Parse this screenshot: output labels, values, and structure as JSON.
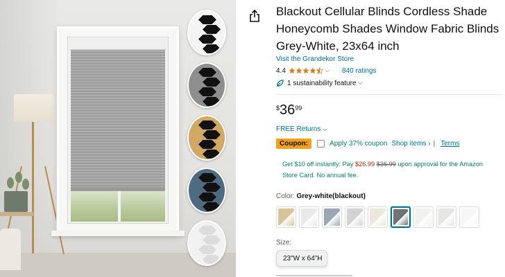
{
  "product": {
    "title": "Blackout Cellular Blinds Cordless Shade Honeycomb Shades Window Fabric Blinds Grey-White, 23x64 inch",
    "store_link": "Visit the Grandekor Store",
    "rating": "4.4",
    "rating_count": "840 ratings",
    "sustainability": "1 sustainability feature",
    "price_symbol": "$",
    "price_whole": "36",
    "price_fraction": "99",
    "returns": "FREE Returns"
  },
  "coupon": {
    "badge": "Coupon:",
    "text": "Apply 37% coupon",
    "shop_items": "Shop items ›",
    "separator": "|",
    "terms": "Terms"
  },
  "promo": {
    "part1": "Get $10 off instantly: Pay ",
    "new_price": "$26.99",
    "old_price": "$36.99",
    "part2": " upon approval for the Amazon Store Card. No annual fee."
  },
  "color": {
    "label": "Color: ",
    "selected": "Grey-white(blackout)",
    "swatches": [
      {
        "name": "beige",
        "color": "#d8c39b"
      },
      {
        "name": "white-line",
        "color": "#e9e9e9"
      },
      {
        "name": "grey-blue",
        "color": "#9aa6b2"
      },
      {
        "name": "light-grey",
        "color": "#d2d2d2"
      },
      {
        "name": "cream",
        "color": "#ece7da"
      },
      {
        "name": "grey-white-blackout",
        "color": "#6e7378"
      },
      {
        "name": "white",
        "color": "#f1f1ef"
      },
      {
        "name": "off-white",
        "color": "#e6e5e2"
      },
      {
        "name": "pure-white",
        "color": "#f6f6f6"
      }
    ]
  },
  "size": {
    "label": "Size:",
    "selected": "23\"W x 64\"H"
  },
  "image_swatches": [
    {
      "name": "black-white",
      "bg": "#f4f4f4",
      "hex": "#111111"
    },
    {
      "name": "grey",
      "bg": "#8e8e8e",
      "hex": "#111111"
    },
    {
      "name": "tan",
      "bg": "#d1a866",
      "hex": "#111111"
    },
    {
      "name": "blue",
      "bg": "#4f6b82",
      "hex": "#111111"
    },
    {
      "name": "white",
      "bg": "#f2f2f2",
      "hex": "#dcdcdc"
    }
  ],
  "colors": {
    "link": "#007185",
    "coupon_badge": "#f2a01d",
    "coupon_green": "#067d62",
    "deal_red": "#b12704",
    "star": "#de7921"
  },
  "icons": {
    "share": "share-icon",
    "star": "star-icon",
    "leaf": "leaf-icon",
    "chevron": "chevron-down-icon",
    "checkbox": "checkbox-icon"
  }
}
